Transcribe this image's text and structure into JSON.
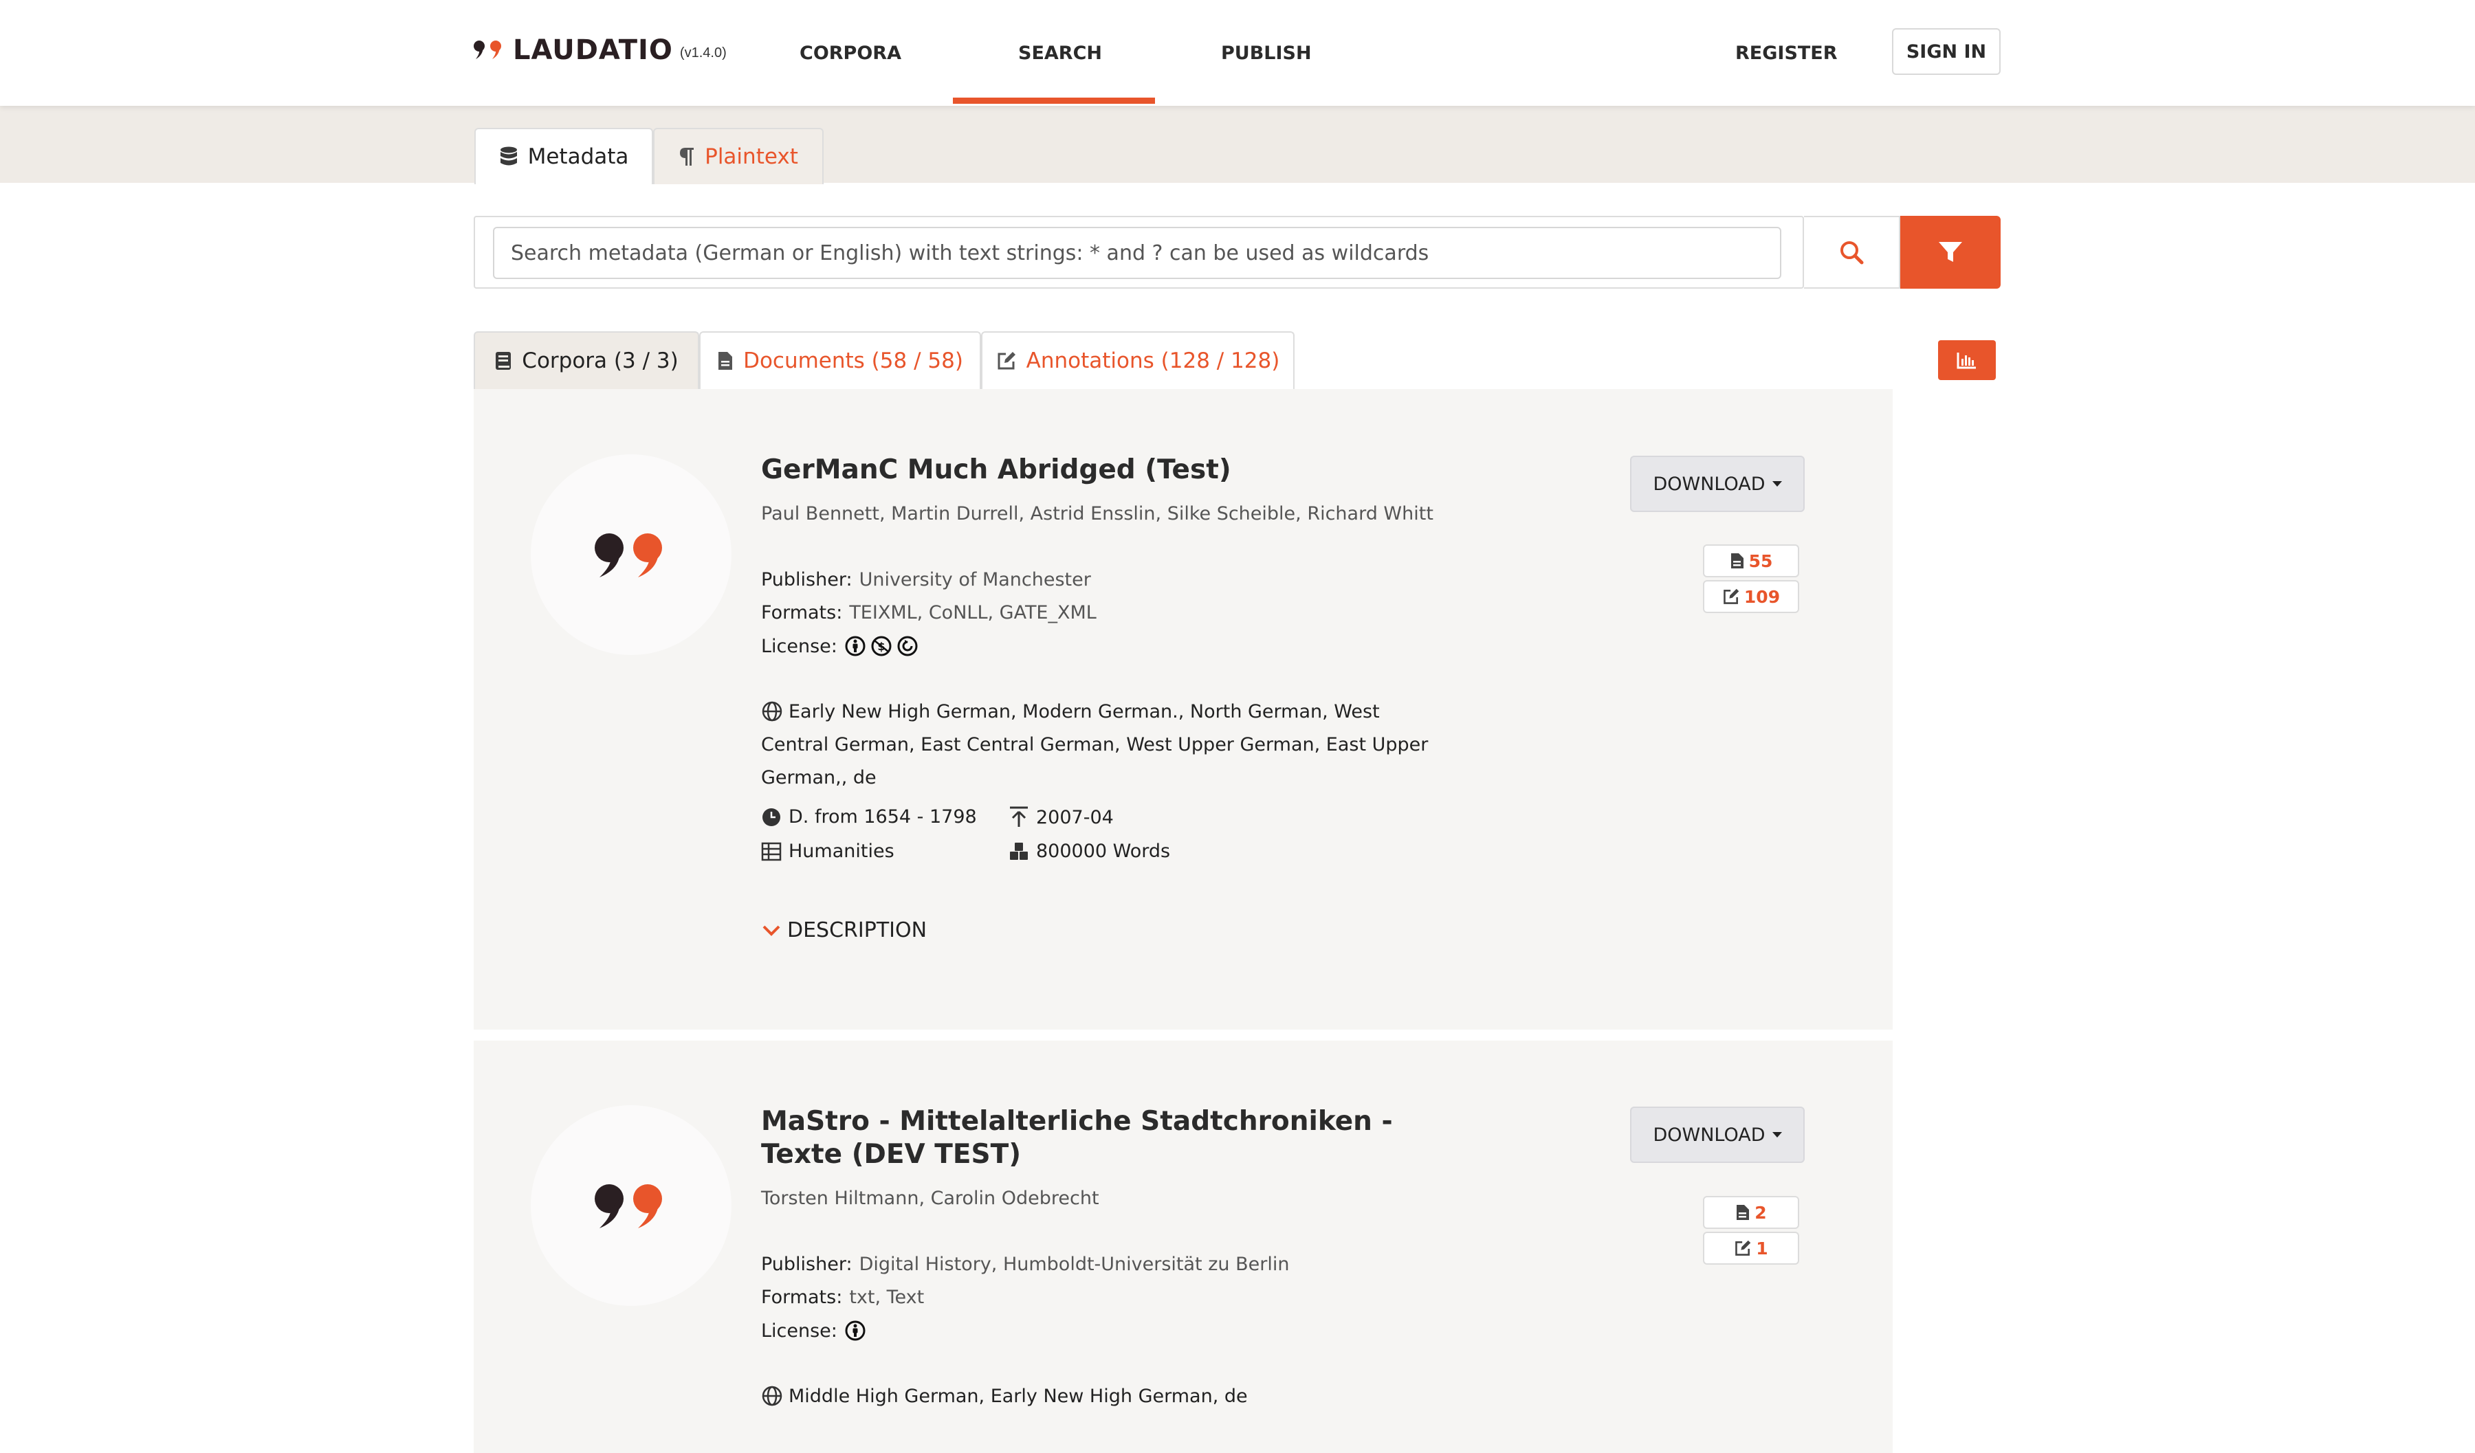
{
  "app": {
    "name": "LAUDATIO",
    "version": "(v1.4.0)"
  },
  "nav": {
    "corpora": "CORPORA",
    "search": "SEARCH",
    "publish": "PUBLISH",
    "register": "REGISTER",
    "sign_in": "SIGN IN",
    "active": "SEARCH"
  },
  "search_type_tabs": {
    "metadata": "Metadata",
    "plaintext": "Plaintext",
    "active": "Metadata"
  },
  "search": {
    "placeholder": "Search metadata (German or English) with text strings: * and ? can be used as wildcards"
  },
  "result_tabs": {
    "corpora": "Corpora (3 / 3)",
    "documents": "Documents (58 / 58)",
    "annotations": "Annotations (128 / 128)",
    "active": "Corpora (3 / 3)"
  },
  "colors": {
    "accent": "#e8552b",
    "dark": "#2a1f22",
    "band": "#efebe6",
    "card": "#f6f5f3"
  },
  "labels": {
    "publisher": "Publisher:",
    "formats": "Formats:",
    "license": "License:",
    "download": "DOWNLOAD",
    "description": "DESCRIPTION"
  },
  "corpora": [
    {
      "title": "GerManC Much Abridged (Test)",
      "authors": "Paul Bennett, Martin Durrell, Astrid Ensslin, Silke Scheible, Richard Whitt",
      "publisher": "University of Manchester",
      "formats": "TEIXML, CoNLL, GATE_XML",
      "license_icons": [
        "cc-by-icon",
        "cc-nc-icon",
        "cc-sa-icon"
      ],
      "languages": "Early New High German, Modern German., North German, West Central German, East Central German, West Upper German, East Upper German,, de",
      "date_range": "D. from 1654 - 1798",
      "published": "2007-04",
      "field": "Humanities",
      "size": "800000 Words",
      "documents_count": "55",
      "annotations_count": "109"
    },
    {
      "title": "MaStro - Mittelalterliche Stadtchroniken - Texte (DEV TEST)",
      "authors": "Torsten Hiltmann, Carolin Odebrecht",
      "publisher": "Digital History, Humboldt-Universität zu Berlin",
      "formats": "txt, Text",
      "license_icons": [
        "cc-by-icon"
      ],
      "languages": "Middle High German, Early New High German, de",
      "documents_count": "2",
      "annotations_count": "1"
    }
  ]
}
